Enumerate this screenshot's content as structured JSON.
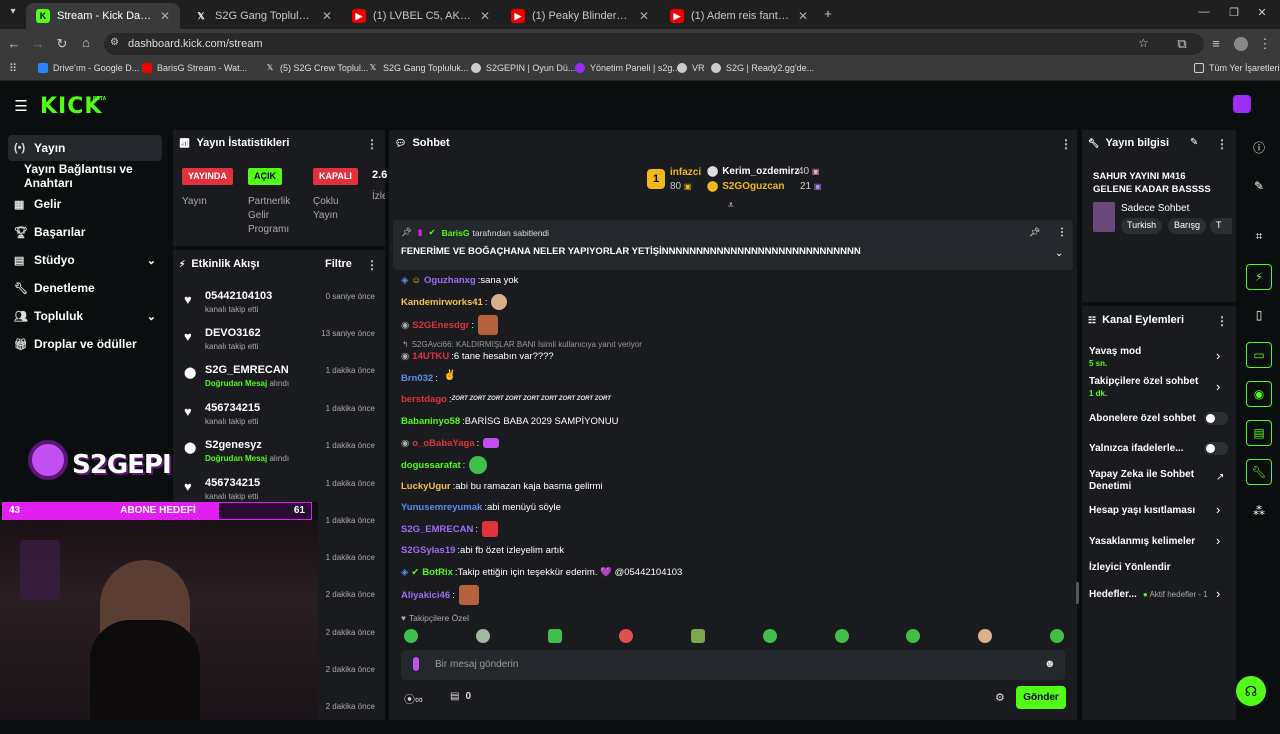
{
  "browser": {
    "tabs": [
      {
        "title": "Stream - Kick Dashboard",
        "icon": "kick-icon"
      },
      {
        "title": "S2G Gang Topluluk / X",
        "icon": "x-icon"
      },
      {
        "title": "(1) LVBEL C5, AKDO - BEN ÜNL",
        "icon": "youtube-icon"
      },
      {
        "title": "(1) Peaky Blinders: Ölümsüz Ad",
        "icon": "youtube-icon"
      },
      {
        "title": "(1) Adem reis fanta kutusuyla o",
        "icon": "youtube-icon"
      }
    ],
    "url": "dashboard.kick.com/stream",
    "bookmarks": [
      "Drive'ım - Google D...",
      "BarisG Stream - Wat...",
      "(5) S2G Crew Toplul...",
      "S2G Gang Topluluk...",
      "S2GEPIN | Oyun Dü...",
      "Yönetim Paneli | s2g...",
      "VR",
      "S2G | Ready2.gg'de..."
    ],
    "bookmarks_all": "Tüm Yer İşaretleri"
  },
  "kick": {
    "logo": "KICK",
    "beta": "BETA"
  },
  "nav": [
    {
      "label": "Yayın",
      "icon": "broadcast-icon"
    },
    {
      "label": "Yayın Bağlantısı ve Anahtarı",
      "icon": ""
    },
    {
      "label": "Gelir",
      "icon": "grid-icon"
    },
    {
      "label": "Başarılar",
      "icon": "trophy-icon"
    },
    {
      "label": "Stüdyo",
      "icon": "studio-icon"
    },
    {
      "label": "Denetleme",
      "icon": "wrench-icon"
    },
    {
      "label": "Topluluk",
      "icon": "users-icon"
    },
    {
      "label": "Droplar ve ödüller",
      "icon": "gift-icon"
    }
  ],
  "stats": {
    "title": "Yayın İstatistikleri",
    "live_badge": "YAYINDA",
    "partner_badge": "AÇIK",
    "multi_badge": "KAPALI",
    "extra": "2.6",
    "extra_label": "İzle",
    "live_label": "Yayın",
    "partner_label": "Partnerlik Gelir Programı",
    "multi_label": "Çoklu Yayın"
  },
  "activity": {
    "title": "Etkinlik Akışı",
    "filter": "Filtre",
    "items": [
      {
        "user": "05442104103",
        "sub": "kanalı takip etti",
        "time": "0 saniye önce",
        "type": "follow"
      },
      {
        "user": "DEVO3162",
        "sub": "kanalı takip etti",
        "time": "13 saniye önce",
        "type": "follow"
      },
      {
        "user": "S2G_EMRECAN",
        "sub_b": "Doğrudan Mesaj",
        "sub": "alındı",
        "time": "1 dakika önce",
        "type": "msg"
      },
      {
        "user": "456734215",
        "sub": "kanalı takip etti",
        "time": "1 dakika önce",
        "type": "follow"
      },
      {
        "user": "S2genesyz",
        "sub_b": "Doğrudan Mesaj",
        "sub": "alındı",
        "time": "1 dakika önce",
        "type": "msg"
      },
      {
        "user": "456734215",
        "sub": "kanalı takip etti",
        "time": "1 dakika önce",
        "type": "follow"
      }
    ],
    "more_times": [
      "1 dakika önce",
      "1 dakika önce",
      "2 dakika önce",
      "2 dakika önce",
      "2 dakika önce",
      "2 dakika önce"
    ]
  },
  "overlay": {
    "brand": "S2GEPIN",
    "goal_label": "ABONE HEDEFİ",
    "goal_current": "43",
    "goal_target": "61",
    "goal_progress": 0.7
  },
  "chat": {
    "title": "Sohbet",
    "leaders": [
      {
        "rank": "1",
        "name": "infazci",
        "value": "80"
      },
      {
        "name": "Kerim_ozdemirz",
        "value": "40"
      },
      {
        "name": "S2GOguzcan",
        "value": "21"
      }
    ],
    "pinned_by_user": "BarisG",
    "pinned_by_text": "tarafından sabitlendi",
    "pinned_text": "FENERİME VE BOĞAÇHANA NELER YAPIYORLAR YETİŞİNNNNNNNNNNNNNNNNNNNNNNNNNNNNN",
    "messages": [
      {
        "user": "Oguzhanxg",
        "color": "#9e6cf7",
        "text": "sana yok"
      },
      {
        "user": "Kandemirworks41",
        "color": "#f2c14e",
        "text": ""
      },
      {
        "user": "S2GEnesdgr",
        "color": "#e0323c",
        "text": ""
      },
      {
        "reply": "S2GAvci66: KALDIRMIŞLAR BANI İsimli kullanıcıya yanıt veriyor"
      },
      {
        "user": "14UTKU",
        "color": "#e0323c",
        "text": "6 tane hesabın var????"
      },
      {
        "user": "Brn032",
        "color": "#5b8def",
        "text": ""
      },
      {
        "user": "berstdago",
        "color": "#e0323c",
        "text": "ZORT ZORT ZORT ZORT ZORT ZORT ZORT ZORT ZORT"
      },
      {
        "user": "Babaninyo58",
        "color": "#53fc18",
        "text": "BARİSG BABA 2029 SAMPİYONUU"
      },
      {
        "user": "o_oBabaYaga",
        "color": "#e0323c",
        "text": ""
      },
      {
        "user": "dogussarafat",
        "color": "#53fc18",
        "text": ""
      },
      {
        "user": "LuckyUgur",
        "color": "#f2c14e",
        "text": "abi bu ramazan kaja basma gelirmi"
      },
      {
        "user": "Yunusemreyumak",
        "color": "#5b8def",
        "text": "abi menüyü söyle"
      },
      {
        "user": "S2G_EMRECAN",
        "color": "#9e6cf7",
        "text": ""
      },
      {
        "user": "S2GSylas19",
        "color": "#9e6cf7",
        "text": "abi fb özet izleyelim artık"
      },
      {
        "user": "BotRix",
        "color": "#53fc18",
        "text": "Takip ettiğin için teşekkür ederim. 💜 @05442104103"
      },
      {
        "user": "Aliyakici46",
        "color": "#9e6cf7",
        "text": ""
      }
    ],
    "followers_only": "Takipçilere Özel",
    "input_placeholder": "Bir mesaj gönderin",
    "points": "0",
    "send": "Gönder"
  },
  "stream_info": {
    "title": "Yayın bilgisi",
    "stream_title": "SAHUR YAYINI M416 GELENE KADAR BASSSS",
    "category": "Sadece Sohbet",
    "tags": [
      "Turkish",
      "Barışg",
      "T"
    ]
  },
  "channel_actions": {
    "title": "Kanal Eylemleri",
    "items": [
      {
        "label": "Yavaş mod",
        "sub": "5 sn.",
        "control": "chevron"
      },
      {
        "label": "Takipçilere özel sohbet",
        "sub": "1 dk.",
        "control": "chevron"
      },
      {
        "label": "Abonelere özel sohbet",
        "sub": "",
        "control": "toggle"
      },
      {
        "label": "Yalnızca ifadelerle...",
        "sub": "",
        "control": "toggle"
      },
      {
        "label": "Yapay Zeka ile Sohbet Denetimi",
        "sub": "",
        "control": "external"
      },
      {
        "label": "Hesap yaşı kısıtlaması",
        "sub": "",
        "control": "chevron"
      },
      {
        "label": "Yasaklanmış kelimeler",
        "sub": "",
        "control": "chevron"
      },
      {
        "label": "İzleyici Yönlendir",
        "sub": "",
        "control": "none"
      },
      {
        "label": "Hedefler...",
        "sub": "Aktif hedefler - 1",
        "control": "chevron"
      }
    ]
  },
  "colors": {
    "kick_green": "#53fc18",
    "live_red": "#e0323c",
    "goal_pink": "#e01ff0"
  }
}
